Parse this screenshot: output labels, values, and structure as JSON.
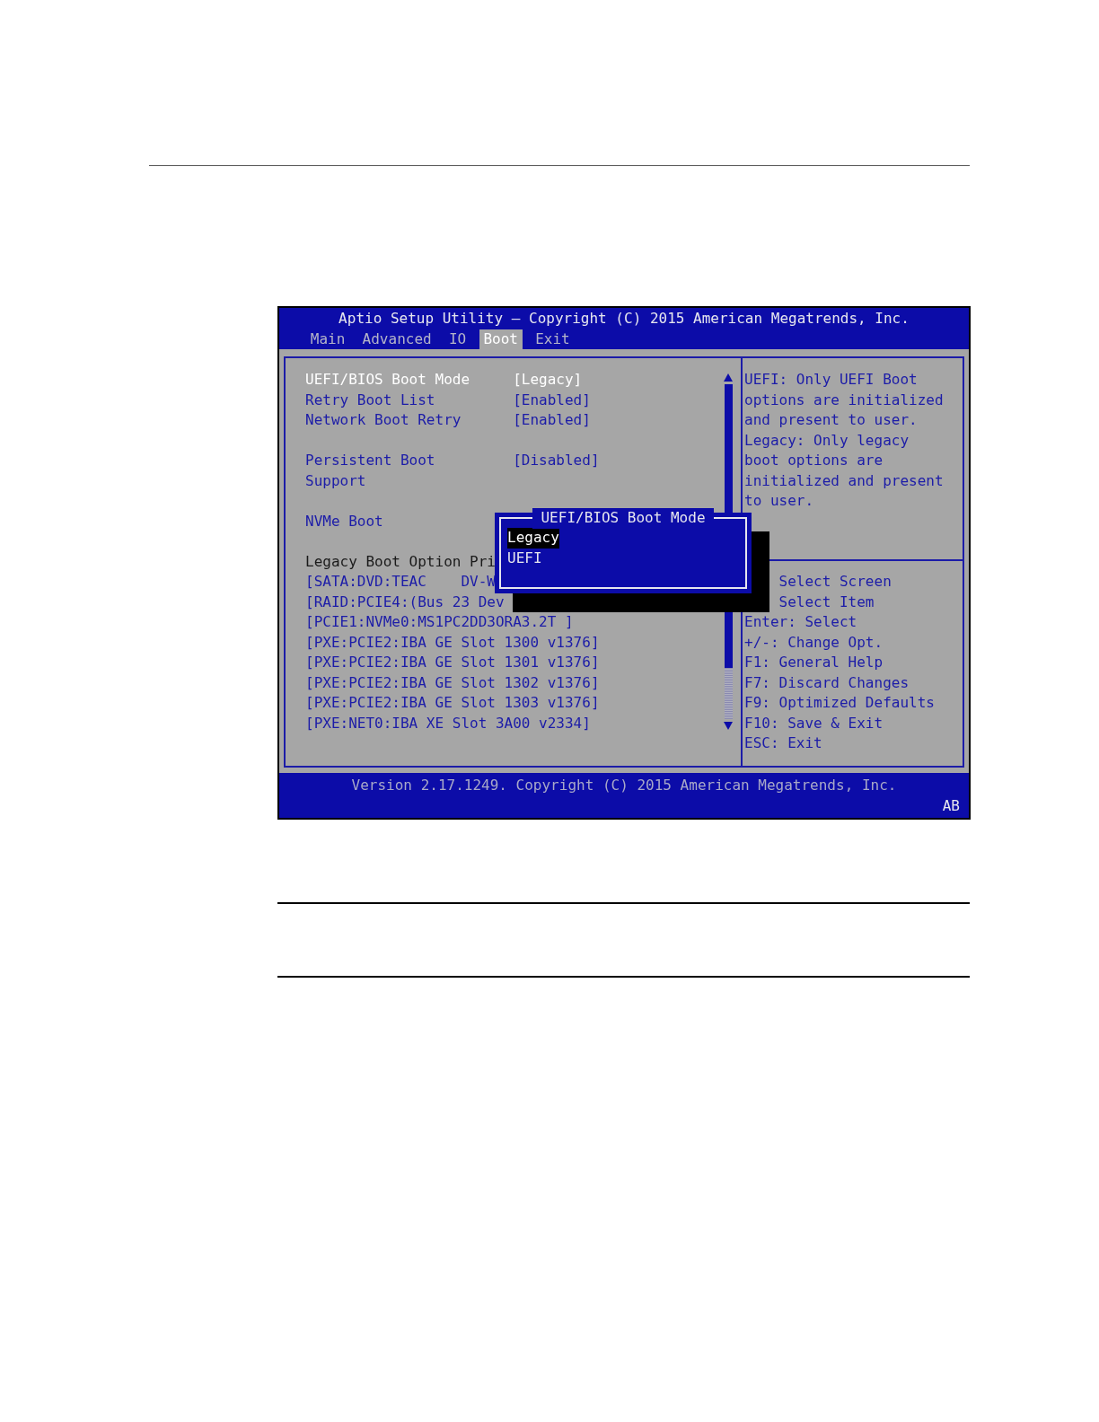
{
  "title": "Aptio Setup Utility – Copyright (C) 2015 American Megatrends, Inc.",
  "tabs": [
    {
      "label": "Main",
      "selected": false
    },
    {
      "label": "Advanced",
      "selected": false
    },
    {
      "label": "IO",
      "selected": false
    },
    {
      "label": "Boot",
      "selected": true
    },
    {
      "label": "Exit",
      "selected": false
    }
  ],
  "setting_groups": [
    {
      "items": [
        {
          "label": "UEFI/BIOS Boot Mode",
          "value": "[Legacy]",
          "selected": true
        },
        {
          "label": "Retry Boot List",
          "value": "[Enabled]",
          "selected": false
        },
        {
          "label": "Network Boot Retry",
          "value": "[Enabled]",
          "selected": false
        }
      ]
    },
    {
      "items": [
        {
          "label": "Persistent Boot Support",
          "value": "[Disabled]",
          "selected": false
        }
      ]
    },
    {
      "items": [
        {
          "label": "NVMe Boot",
          "selected": false
        }
      ]
    }
  ],
  "boot_priority": {
    "heading": "Legacy Boot Option Pri",
    "options": [
      "[SATA:DVD:TEAC    DV-W",
      "[RAID:PCIE4:(Bus 23 Dev",
      "[PCIE1:NVMe0:MS1PC2DD3ORA3.2T ]",
      "[PXE:PCIE2:IBA GE Slot 1300 v1376]",
      "[PXE:PCIE2:IBA GE Slot 1301 v1376]",
      "[PXE:PCIE2:IBA GE Slot 1302 v1376]",
      "[PXE:PCIE2:IBA GE Slot 1303 v1376]",
      "[PXE:NET0:IBA XE Slot 3A00 v2334]"
    ]
  },
  "help": {
    "description": "UEFI: Only UEFI Boot options are initialized and present to user. Legacy: Only legacy boot options are initialized and present to user.",
    "keys": [
      {
        "kind": "obscured",
        "text": "Select Screen"
      },
      {
        "kind": "obscured",
        "text": "Select Item"
      },
      {
        "kind": "key",
        "text": "Enter: Select"
      },
      {
        "kind": "key",
        "text": "+/-: Change Opt."
      },
      {
        "kind": "key",
        "text": "F1: General Help"
      },
      {
        "kind": "key",
        "text": "F7: Discard Changes"
      },
      {
        "kind": "key",
        "text": "F9: Optimized Defaults"
      },
      {
        "kind": "key",
        "text": "F10: Save & Exit"
      },
      {
        "kind": "key",
        "text": "ESC: Exit"
      }
    ]
  },
  "popup": {
    "title": "UEFI/BIOS Boot Mode",
    "options": [
      {
        "label": "Legacy",
        "selected": true
      },
      {
        "label": "UEFI",
        "selected": false
      }
    ]
  },
  "footer": {
    "version": "Version 2.17.1249. Copyright (C) 2015 American Megatrends, Inc.",
    "status": "AB"
  }
}
